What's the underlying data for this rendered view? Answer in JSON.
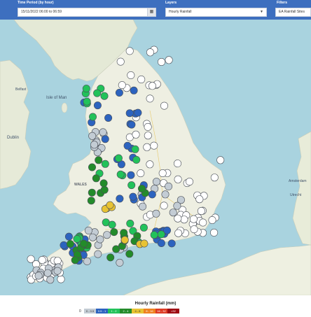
{
  "filters": {
    "time_period": {
      "label": "Time Period (by hour)",
      "value": "15/11/2022 06:00 to 06:59"
    },
    "layers": {
      "label": "Layers",
      "value": "Hourly Rainfall"
    },
    "filters": {
      "label": "Filters",
      "value": "EA Rainfall Sites"
    }
  },
  "map": {
    "places": [
      {
        "name": "Isle of Man"
      },
      {
        "name": "Belfast"
      },
      {
        "name": "Dublin"
      },
      {
        "name": "WALES"
      },
      {
        "name": "Amsterdam"
      },
      {
        "name": "Utrecht"
      }
    ],
    "stations": {
      "0": 86,
      "0-0.5": 44,
      "0.5-1": 46,
      "1-2": 31,
      "2-4": 29,
      "4-8": 7
    }
  },
  "legend": {
    "title": "Hourly Rainfall (mm)",
    "zero": "0",
    "bins": [
      {
        "label": "0 - 0.5",
        "color": "#c3ccd4"
      },
      {
        "label": "0.5 - 1",
        "color": "#2c63bf"
      },
      {
        "label": "1 - 2",
        "color": "#22c25a"
      },
      {
        "label": "2 - 4",
        "color": "#238b2a"
      },
      {
        "label": "4 - 8",
        "color": "#e8c334"
      },
      {
        "label": "8 - 16",
        "color": "#ee8120"
      },
      {
        "label": "16 - 32",
        "color": "#dd3a23"
      },
      {
        "label": ">32",
        "color": "#9e0c12"
      }
    ],
    "zero_color": "#ffffff"
  }
}
